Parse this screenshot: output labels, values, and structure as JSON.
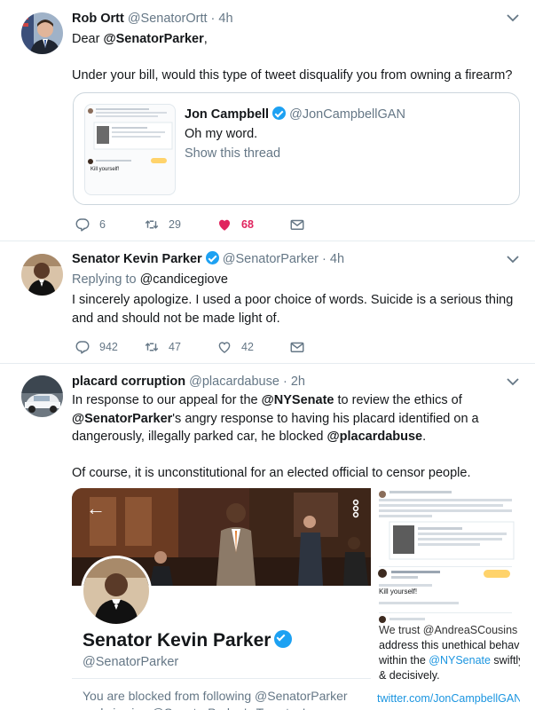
{
  "tweet1": {
    "name": "Rob Ortt",
    "handle": "@SenatorOrtt",
    "time": "4h",
    "line1_prefix": "Dear ",
    "line1_mention": "@SenatorParker",
    "line1_suffix": ",",
    "line2": "Under your bill, would this type of tweet disqualify you from owning a firearm?",
    "quote": {
      "name": "Jon Campbell",
      "handle": "@JonCampbellGAN",
      "text": "Oh my word.",
      "show_thread": "Show this thread",
      "thumb_text": "Kill yourself!"
    },
    "replies": "6",
    "retweets": "29",
    "likes": "68"
  },
  "tweet2": {
    "name": "Senator Kevin Parker",
    "handle": "@SenatorParker",
    "time": "4h",
    "replying_label": "Replying to ",
    "replying_to": "@candicegiove",
    "text": "I sincerely apologize.  I used a  poor choice of words.  Suicide is a serious thing and and should not be made light of.",
    "replies": "942",
    "retweets": "47",
    "likes": "42"
  },
  "tweet3": {
    "name": "placard corruption",
    "handle": "@placardabuse",
    "time": "2h",
    "p1_a": "In response to our appeal for the ",
    "p1_m1": "@NYSenate",
    "p1_b": " to review the ethics of ",
    "p1_m2": "@SenatorParker",
    "p1_c": "'s angry response to having his placard identified on a dangerously, illegally parked car, he blocked ",
    "p1_m3": "@placardabuse",
    "p1_d": ".",
    "p2": "Of course, it is unconstitutional for an elected official to censor people.",
    "profile": {
      "name": "Senator Kevin Parker",
      "handle": "@SenatorParker",
      "blocked": "You are blocked from following @SenatorParker and viewing @SenatorParker's Tweets. Learn more"
    },
    "side": {
      "kill": "Kill yourself!",
      "line1": "We trust @AndreaSCousins will",
      "line2": "address this unethical behavior",
      "line3_a": "within the ",
      "line3_m": "@NYSenate",
      "line3_b": " swiftly",
      "line4": "& decisively.",
      "link": "twitter.com/JonCampbellGAN..."
    }
  },
  "colors": {
    "accent": "#1da1f2",
    "link": "#1b95e0",
    "like": "#e0245e",
    "muted": "#657786",
    "divider": "#e6ecf0"
  }
}
